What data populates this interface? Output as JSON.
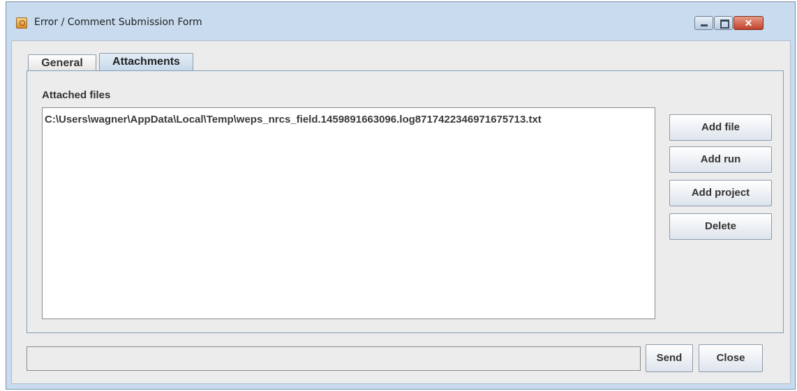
{
  "window": {
    "title": "Error / Comment Submission Form",
    "controls": {
      "close_glyph": "✕"
    }
  },
  "tabs": [
    {
      "label": "General",
      "selected": false
    },
    {
      "label": "Attachments",
      "selected": true
    }
  ],
  "attachments": {
    "label": "Attached files",
    "files": [
      "C:\\Users\\wagner\\AppData\\Local\\Temp\\weps_nrcs_field.1459891663096.log8717422346971675713.txt"
    ],
    "buttons": {
      "add_file": "Add file",
      "add_run": "Add run",
      "add_project": "Add project",
      "delete": "Delete"
    }
  },
  "footer": {
    "status_value": "",
    "send": "Send",
    "close": "Close"
  },
  "icons": {
    "app": "java-app-icon",
    "minimize": "minimize-icon",
    "maximize": "maximize-icon",
    "close": "close-icon"
  },
  "colors": {
    "titlebar": "#c9dcef",
    "close_button": "#c1432c",
    "selected_tab": "#c7d8ea"
  }
}
